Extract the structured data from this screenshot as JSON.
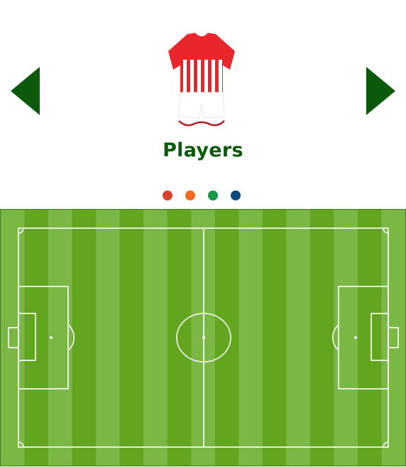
{
  "navigation": {
    "prev_icon": "triangle-left-icon",
    "next_icon": "triangle-right-icon",
    "arrow_color": "#0b5a0b"
  },
  "kit": {
    "icon": "jersey-icon",
    "shirt_colors": [
      "#e8262c",
      "#ffffff"
    ],
    "shorts_color": "#ffffff",
    "socks_color": "#b01e24"
  },
  "section": {
    "title": "Players"
  },
  "pager": {
    "dots": [
      {
        "color": "#d9412f",
        "active": true
      },
      {
        "color": "#f06a1f",
        "active": false
      },
      {
        "color": "#17994a",
        "active": false
      },
      {
        "color": "#0d4a7a",
        "active": false
      }
    ]
  },
  "pitch": {
    "icon": "football-pitch-icon",
    "grass_dark": "#62a51e",
    "grass_light": "#7bb744",
    "line_color": "#ffffff"
  }
}
